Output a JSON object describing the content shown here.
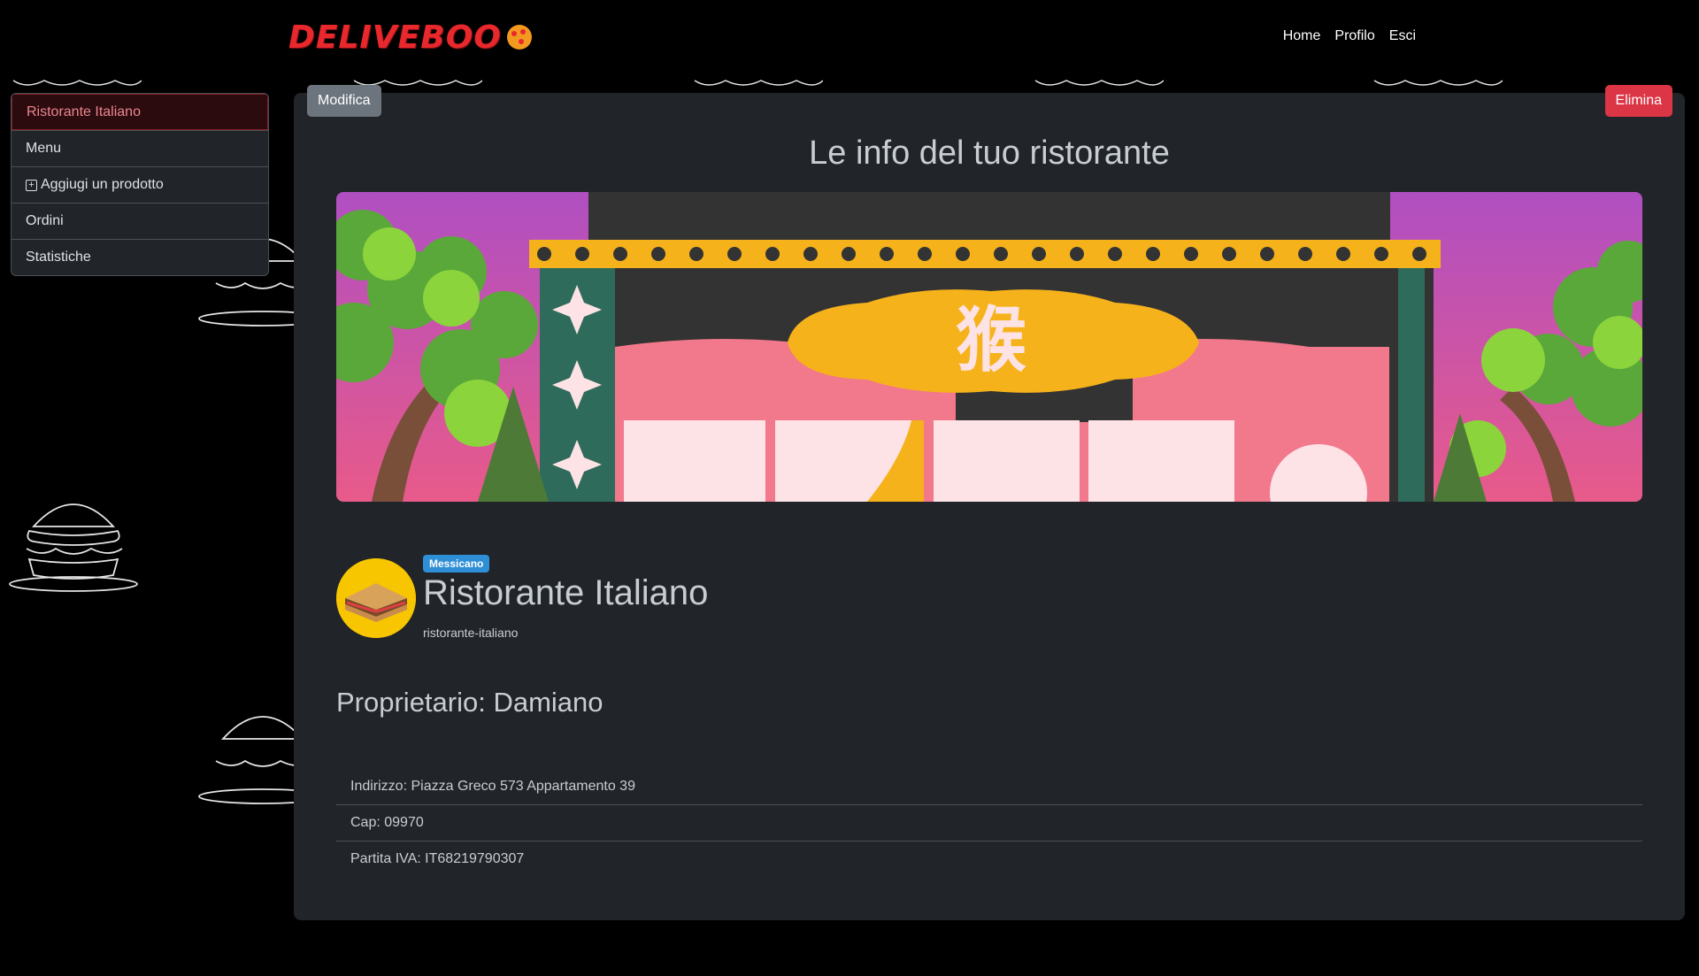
{
  "header": {
    "logo_text": "DELIVEBOO",
    "nav": [
      {
        "label": "Home"
      },
      {
        "label": "Profilo"
      },
      {
        "label": "Esci"
      }
    ]
  },
  "sidebar": {
    "items": [
      {
        "label": "Ristorante Italiano",
        "active": true
      },
      {
        "label": "Menu"
      },
      {
        "label": "Aggiugi un prodotto",
        "icon": "plus-square-icon"
      },
      {
        "label": "Ordini"
      },
      {
        "label": "Statistiche"
      }
    ]
  },
  "main": {
    "edit_label": "Modifica",
    "delete_label": "Elimina",
    "title": "Le info del tuo ristorante",
    "category_badge": "Messicano",
    "restaurant_name": "Ristorante Italiano",
    "slug": "ristorante-italiano",
    "owner": "Proprietario: Damiano",
    "sign_character": "猴",
    "info": [
      {
        "text": "Indirizzo: Piazza Greco 573 Appartamento 39"
      },
      {
        "text": "Cap: 09970"
      },
      {
        "text": "Partita IVA: IT68219790307"
      }
    ]
  },
  "colors": {
    "accent_red": "#dc3545",
    "secondary": "#6c757d",
    "card_bg": "#212529",
    "badge_blue": "#2f8fd6"
  }
}
